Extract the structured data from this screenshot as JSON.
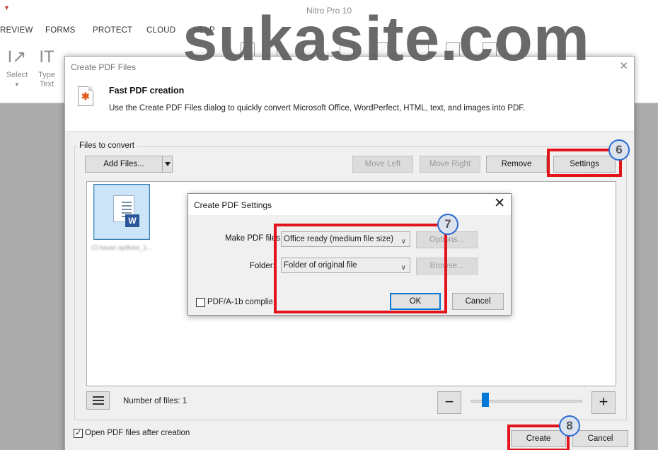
{
  "app": {
    "window_title": "Nitro Pro 10"
  },
  "menu": [
    "REVIEW",
    "FORMS",
    "PROTECT",
    "CLOUD",
    "HELP"
  ],
  "ribbon": {
    "select_label": "Select",
    "type_label": "Type",
    "type_label_2": "Text"
  },
  "create_dialog": {
    "title": "Create PDF Files",
    "heading": "Fast PDF creation",
    "description": "Use the Create PDF Files dialog to quickly convert Microsoft Office, WordPerfect, HTML, text, and images into PDF.",
    "files_group_label": "Files to convert",
    "buttons": {
      "add_files": "Add Files...",
      "move_left": "Move Left",
      "move_right": "Move Right",
      "remove": "Remove",
      "settings": "Settings",
      "create": "Create",
      "cancel": "Cancel"
    },
    "file_name": "Cl hasan aplikasi_1...",
    "file_count_label": "Number of files: 1",
    "open_after_label": "Open PDF files after creation",
    "open_after_checked": true,
    "zoom_minus": "−",
    "zoom_plus": "+",
    "zoom_level": 0.12
  },
  "settings_dialog": {
    "title": "Create PDF Settings",
    "make_pdf_label": "Make PDF files:",
    "make_pdf_value": "Office ready (medium file size)",
    "options_label": "Options...",
    "folder_label": "Folder:",
    "folder_value": "Folder of original file",
    "browse_label": "Browse...",
    "pdfa_label": "PDF/A-1b compliance",
    "pdfa_checked": false,
    "ok_label": "OK",
    "cancel_label": "Cancel"
  },
  "annotations": {
    "step_6": "6",
    "step_7": "7",
    "step_8": "8",
    "highlight_color": "#e3131b",
    "badge_border": "#2a6ad1"
  },
  "watermark": "sukasite.com"
}
